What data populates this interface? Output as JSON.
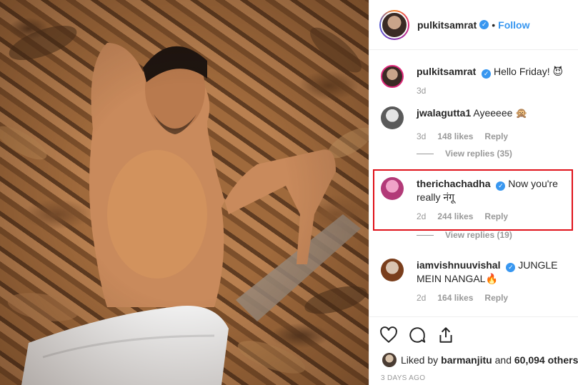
{
  "post": {
    "username": "pulkitsamrat",
    "follow_label": "Follow",
    "dot": "•",
    "verified_glyph": "✓"
  },
  "comments": [
    {
      "user": "pulkitsamrat",
      "text": "Hello Friday! 😈",
      "time": "3d"
    },
    {
      "user": "jwalagutta1",
      "text": "Ayeeeee 🙊",
      "time": "3d",
      "likes": "148 likes",
      "reply": "Reply",
      "view_replies": "View replies (35)"
    },
    {
      "user": "therichachadha",
      "text": "Now you're really नंगू",
      "time": "2d",
      "likes": "244 likes",
      "reply": "Reply",
      "view_replies": "View replies (19)"
    },
    {
      "user": "iamvishnuuvishal",
      "text": "JUNGLE MEIN NANGAL🔥",
      "time": "2d",
      "likes": "164 likes",
      "reply": "Reply"
    }
  ],
  "likes_line": {
    "prefix": "Liked by ",
    "user": "barmanjitu",
    "middle": " and ",
    "count": "60,094 others"
  },
  "timestamp": "3 DAYS AGO",
  "icons": [
    "heart-icon",
    "comment-icon",
    "share-icon"
  ],
  "colors": {
    "accent": "#3897f0",
    "highlight": "#e0121a",
    "muted": "#999999"
  }
}
